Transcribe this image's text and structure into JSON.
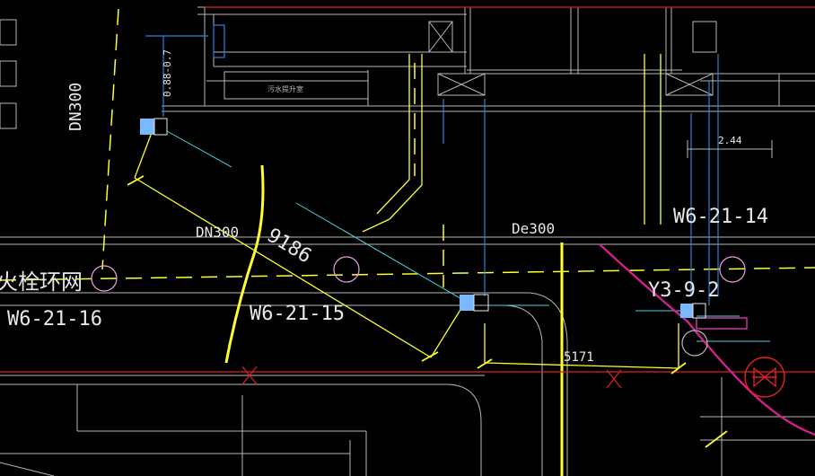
{
  "drawing": {
    "background": "#000000",
    "colors": {
      "grid": "#b8b8b8",
      "yellow": "#ffff30",
      "cyan": "#40d8e0",
      "blue": "#2f7fe0",
      "red": "#e02020",
      "magenta": "#d0208a",
      "white": "#e8e8e8",
      "fixture": "#7ab8ff",
      "pink": "#ff44cc",
      "pale_pink": "#e8a0e8"
    },
    "labels": {
      "dn300_vertical": "DN300",
      "elev": "0.88-0.7",
      "room_small": "污水提升室",
      "dn300_top": "DN300",
      "de300": "De300",
      "len_9186": "9186",
      "len_5171": "5171",
      "dim_244": "2.44",
      "w6_21_14": "W6-21-14",
      "w6_21_15": "W6-21-15",
      "w6_21_16": "W6-21-16",
      "y3_9_2": "Y3-9-2",
      "fire_loop": "火栓环网"
    }
  }
}
